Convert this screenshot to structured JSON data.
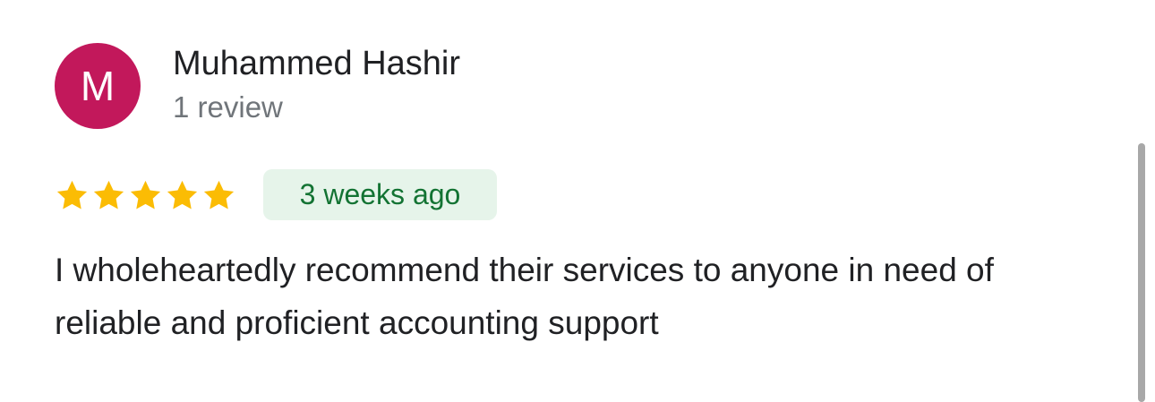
{
  "reviewer": {
    "initial": "M",
    "name": "Muhammed Hashir",
    "review_count": "1 review",
    "avatar_color": "#c2185b"
  },
  "rating": {
    "stars": 5,
    "max_stars": 5,
    "star_color": "#fbbc04"
  },
  "date": {
    "label": "3 weeks ago",
    "badge_bg": "#e6f4ea",
    "badge_text_color": "#137333"
  },
  "review": {
    "text": "I wholeheartedly recommend their services to anyone in need of reliable and proficient accounting support"
  }
}
